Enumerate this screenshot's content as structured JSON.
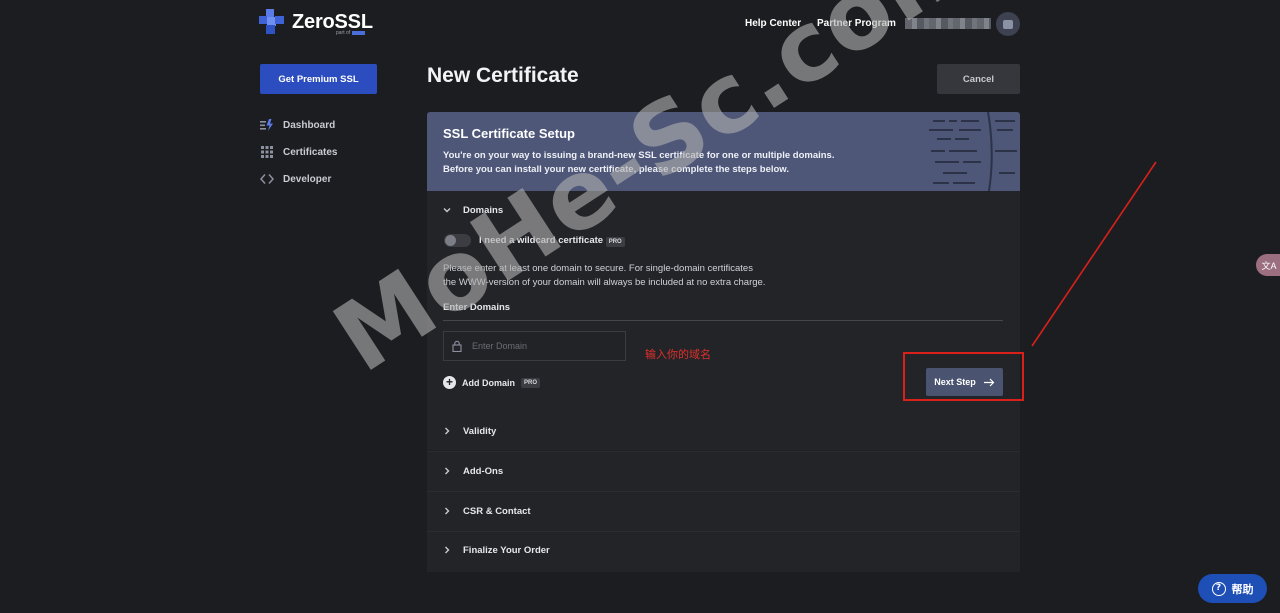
{
  "header": {
    "logo_text": "ZeroSSL",
    "logo_sub": "part of",
    "links": [
      "Help Center",
      "Partner Program"
    ]
  },
  "sidebar": {
    "premium_button": "Get Premium SSL",
    "items": [
      {
        "label": "Dashboard",
        "icon": "dashboard-icon"
      },
      {
        "label": "Certificates",
        "icon": "grid-icon"
      },
      {
        "label": "Developer",
        "icon": "code-icon"
      }
    ]
  },
  "main": {
    "title": "New Certificate",
    "cancel_label": "Cancel",
    "banner": {
      "title": "SSL Certificate Setup",
      "line1": "You're on your way to issuing a brand-new SSL certificate for one or multiple domains.",
      "line2": "Before you can install your new certificate, please complete the steps below."
    },
    "domains": {
      "heading": "Domains",
      "wildcard_label": "I need a wildcard certificate",
      "pro_badge": "PRO",
      "description_line1": "Please enter at least one domain to secure. For single-domain certificates",
      "description_line2": "the WWW-version of your domain will always be included at no extra charge.",
      "enter_label": "Enter Domains",
      "input_placeholder": "Enter Domain",
      "input_value": "",
      "add_domain": "Add Domain",
      "next_step": "Next Step"
    },
    "sections": [
      "Validity",
      "Add-Ons",
      "CSR & Contact",
      "Finalize Your Order"
    ]
  },
  "annotation": {
    "text": "输入你的域名",
    "color": "#d9201a"
  },
  "watermark": "MoHe-Sc.com",
  "floating": {
    "translate": "文A",
    "help": "帮助"
  },
  "colors": {
    "background": "#1c1d20",
    "accent": "#2c4dbf",
    "banner": "#4e5778",
    "next_button": "#4a5470"
  }
}
